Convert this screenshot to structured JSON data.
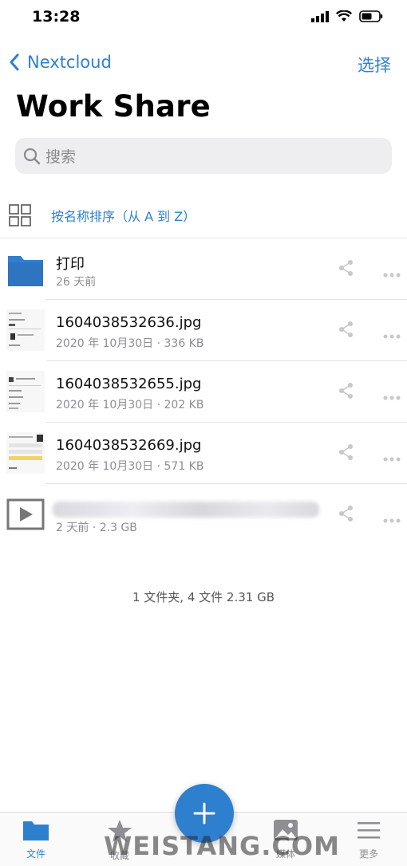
{
  "status_bar": {
    "time": "13:28"
  },
  "nav": {
    "back_label": "Nextcloud",
    "select_label": "选择"
  },
  "title": "Work Share",
  "search": {
    "placeholder": "搜索"
  },
  "sort": {
    "label": "按名称排序（从 A 到 Z）"
  },
  "files": [
    {
      "name": "打印",
      "meta": "26 天前",
      "type": "folder"
    },
    {
      "name": "1604038532636.jpg",
      "meta": "2020 年 10月30日 · 336 KB",
      "type": "image"
    },
    {
      "name": "1604038532655.jpg",
      "meta": "2020 年 10月30日 · 202 KB",
      "type": "image"
    },
    {
      "name": "1604038532669.jpg",
      "meta": "2020 年 10月30日 · 571 KB",
      "type": "image"
    },
    {
      "name": "",
      "meta": "2 天前 · 2.3 GB",
      "type": "video"
    }
  ],
  "summary": "1 文件夹, 4 文件 2.31 GB",
  "tabs": [
    {
      "label": "文件",
      "icon": "folder-icon",
      "active": true
    },
    {
      "label": "收藏",
      "icon": "star-icon",
      "active": false
    },
    {
      "label": "媒体",
      "icon": "photo-icon",
      "active": false
    },
    {
      "label": "更多",
      "icon": "menu-icon",
      "active": false
    }
  ],
  "watermark": "WEISTANG.COM",
  "colors": {
    "accent": "#2f7fcf",
    "text_secondary": "#8e8e93",
    "search_bg": "#eeeef0"
  }
}
